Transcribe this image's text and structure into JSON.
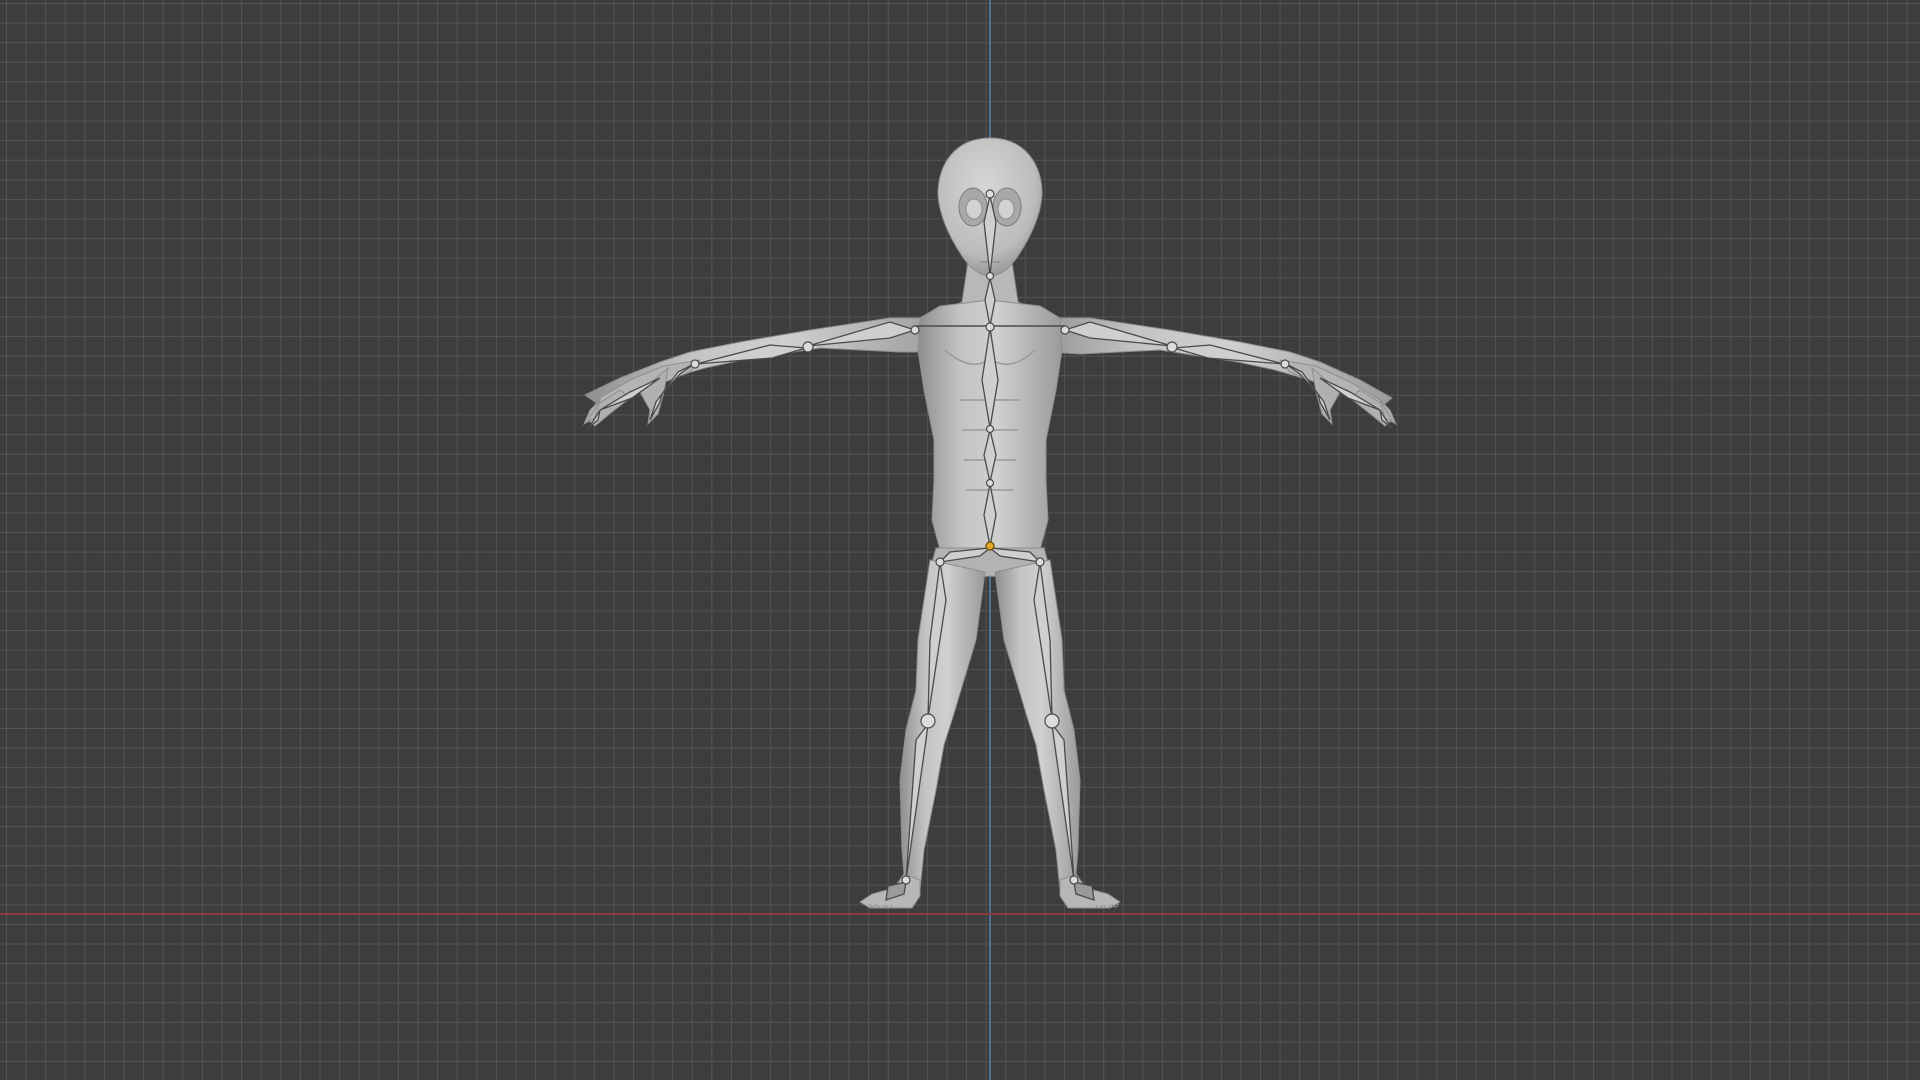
{
  "app": {
    "name": "3D viewport",
    "view": "front-orthographic"
  },
  "viewport": {
    "background_color": "#3d3d3d",
    "grid_color": "#585858",
    "axis_colors": {
      "x": "#8a3b40",
      "y": "#4c6f94"
    }
  },
  "scene": {
    "objects": [
      {
        "kind": "mesh",
        "icon": "humanoid-mesh-icon",
        "color": "#b9b9b9"
      },
      {
        "kind": "armature",
        "icon": "armature-bones-icon",
        "color": "#c8c8c8"
      }
    ],
    "origin_marker_color": "#e3a928"
  }
}
